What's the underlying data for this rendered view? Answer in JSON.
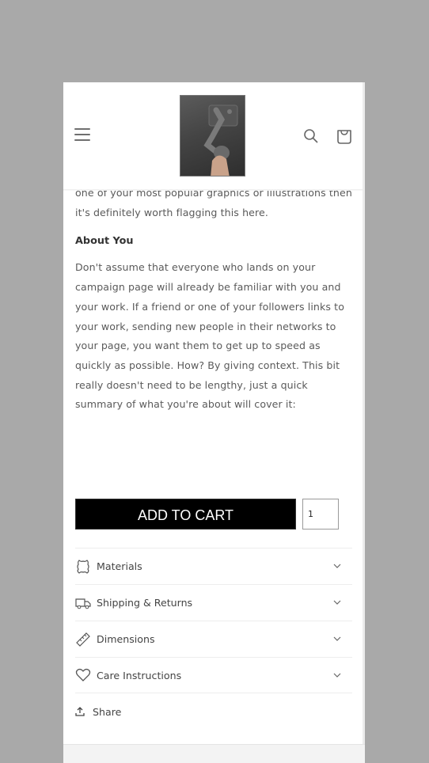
{
  "header": {
    "menu_icon": "hamburger-icon",
    "logo_alt": "phone gimbal product image",
    "search_icon": "search-icon",
    "cart_icon": "shopping-bag-icon"
  },
  "content": {
    "intro_lines": "one of your most popular graphics or illustrations then it's definitely worth flagging this here.",
    "about_heading": "About You",
    "about_body": "Don't assume that everyone who lands on your campaign page will already be familiar with you and your work. If a friend or one of your followers links to your work, sending new people in their networks to your page, you want them to get up to speed as quickly as possible. How? By giving context. This bit really doesn't need to be lengthy, just a quick summary of what you're about will cover it:"
  },
  "purchase": {
    "add_to_cart_label": "ADD TO CART",
    "quantity_value": "1"
  },
  "accordion": [
    {
      "label": "Materials",
      "icon": "leather-icon"
    },
    {
      "label": "Shipping & Returns",
      "icon": "truck-icon"
    },
    {
      "label": "Dimensions",
      "icon": "ruler-icon"
    },
    {
      "label": "Care Instructions",
      "icon": "heart-icon"
    }
  ],
  "share": {
    "label": "Share",
    "icon": "share-icon"
  }
}
